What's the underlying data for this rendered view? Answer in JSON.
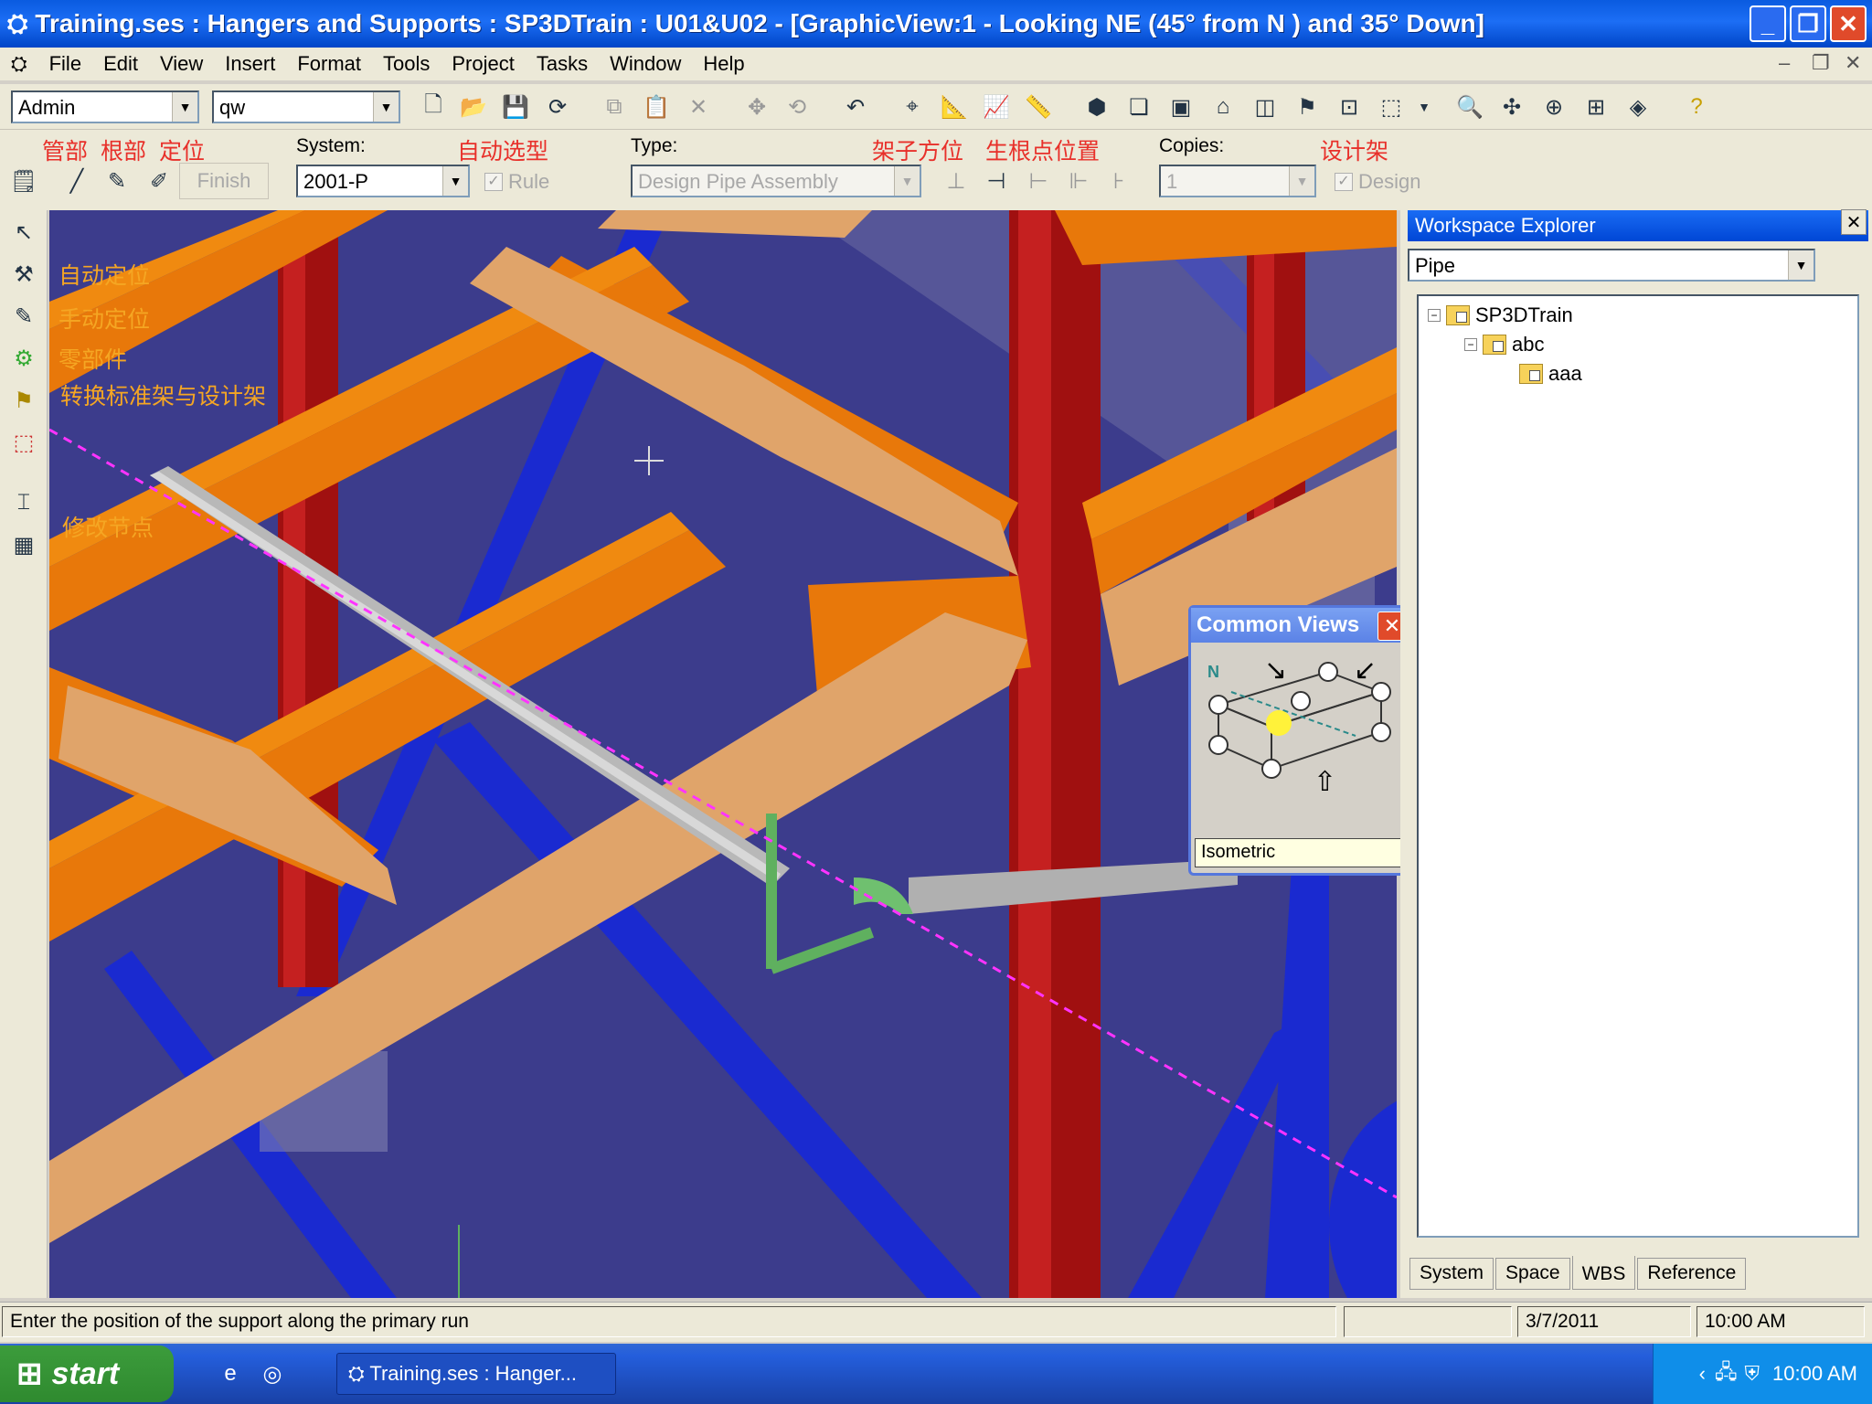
{
  "window": {
    "title": "Training.ses : Hangers and Supports : SP3DTrain : U01&U02 - [GraphicView:1 - Looking NE (45° from N ) and 35° Down]",
    "minimize": "_",
    "restore": "❐",
    "close": "✕"
  },
  "menu": [
    "File",
    "Edit",
    "View",
    "Insert",
    "Format",
    "Tools",
    "Project",
    "Tasks",
    "Window",
    "Help"
  ],
  "toolbar": {
    "user_value": "Admin",
    "filter_value": "qw"
  },
  "ribbon": {
    "annotations": {
      "pipe": "管部",
      "root": "根部",
      "position": "定位",
      "auto_select": "自动选型",
      "orientation": "架子方位",
      "root_point": "生根点位置",
      "design_support": "设计架"
    },
    "finish_label": "Finish",
    "system_label": "System:",
    "system_value": "2001-P",
    "rule_label": "Rule",
    "rule_checked": true,
    "type_label": "Type:",
    "type_value": "Design Pipe Assembly",
    "copies_label": "Copies:",
    "copies_value": "1",
    "design_label": "Design",
    "design_checked": true
  },
  "viewport": {
    "annotations": {
      "auto_place": "自动定位",
      "manual_place": "手动定位",
      "parts": "零部件",
      "convert": "转换标准架与设计架",
      "modify_node": "修改节点"
    },
    "colors": {
      "background": "#3c3c8c",
      "steel_beam": "#f08a10",
      "column": "#b01010",
      "brace": "#1020c8",
      "pipe": "#b8b8b8",
      "support": "#5fb05f",
      "route_line": "#ff33ff"
    }
  },
  "common_views": {
    "title": "Common Views",
    "north_label": "N",
    "view_name": "Isometric"
  },
  "workspace": {
    "title": "Workspace Explorer",
    "filter_value": "Pipe",
    "tree": [
      {
        "label": "SP3DTrain",
        "expanded": true
      },
      {
        "label": "abc",
        "expanded": true
      },
      {
        "label": "aaa",
        "expanded": false
      }
    ],
    "tabs": [
      "System",
      "Space",
      "WBS",
      "Reference"
    ],
    "active_tab": "WBS"
  },
  "status": {
    "prompt": "Enter the position of the support along the primary run",
    "date": "3/7/2011",
    "time": "10:00 AM"
  },
  "taskbar": {
    "start_label": "start",
    "task_label": "Training.ses : Hanger...",
    "clock": "10:00 AM"
  }
}
